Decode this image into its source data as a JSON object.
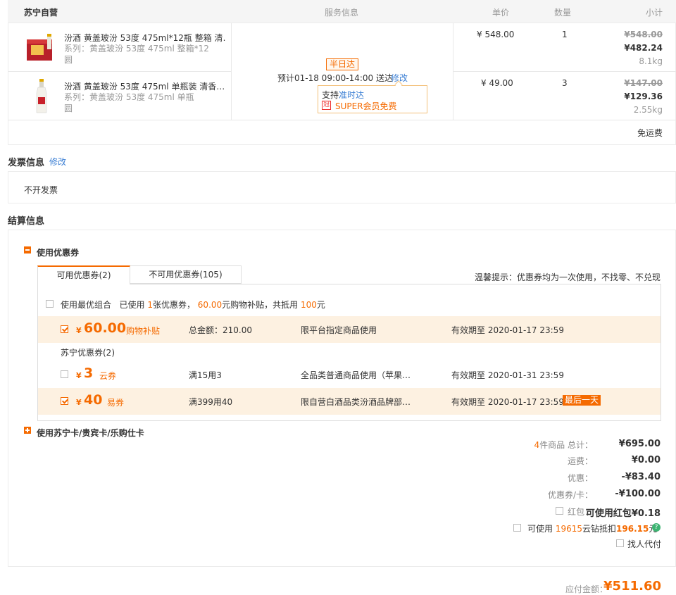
{
  "store": {
    "name": "苏宁自营",
    "col_service": "服务信息",
    "col_price": "单价",
    "col_qty": "数量",
    "col_subtotal": "小计"
  },
  "items": [
    {
      "title": "汾酒 黄盖玻汾 53度 475ml*12瓶 整箱 清…",
      "series": "系列：黄盖玻汾 53度 475ml 整箱*12",
      "tag": "圆",
      "price": "¥ 548.00",
      "qty": "1",
      "orig": "¥548.00",
      "final": "¥482.24",
      "weight": "8.1kg"
    },
    {
      "title": "汾酒 黄盖玻汾 53度 475ml 单瓶装 清香…",
      "series": "系列：黄盖玻汾 53度 475ml 单瓶",
      "tag": "圆",
      "price": "¥ 49.00",
      "qty": "3",
      "orig": "¥147.00",
      "final": "¥129.36",
      "weight": "2.55kg"
    }
  ],
  "delivery": {
    "badge": "半日达",
    "eta": "预计01-18 09:00-14:00  送达",
    "modify": "修改",
    "support_prefix": "支持",
    "support_link": "准时达",
    "super_icon": "冠",
    "super": "SUPER会员免费"
  },
  "shipping_free": "免运费",
  "invoice": {
    "title": "发票信息",
    "modify": "修改",
    "value": "不开发票"
  },
  "settle": {
    "title": "结算信息",
    "use_coupon": "使用优惠券",
    "tab_available": "可用优惠券(2)",
    "tab_unavailable": "不可用优惠券(105)",
    "tip": "温馨提示：优惠券均为一次使用，不找零、不兑现",
    "best_combo": {
      "label": "使用最优组合",
      "p1": "已使用",
      "count": "1",
      "p2": "张优惠券，",
      "amount": "60.00",
      "p3": "元购物补贴，共抵用",
      "total": "100",
      "p4": "元"
    },
    "coupons": [
      {
        "yen": "¥",
        "amount": "60.00",
        "type": "购物补贴",
        "cond": "总金额：210.00",
        "scope": "限平台指定商品使用",
        "expire": "有效期至 2020-01-17 23:59",
        "badge": "",
        "checked": true
      },
      {
        "yen": "¥",
        "amount": "3",
        "type": "云券",
        "cond": "满15用3",
        "scope": "全品类普通商品使用（苹果…",
        "expire": "有效期至 2020-01-31 23:59",
        "badge": "",
        "checked": false
      },
      {
        "yen": "¥",
        "amount": "40",
        "type": "易券",
        "cond": "满399用40",
        "scope": "限自营白酒品类汾酒品牌部…",
        "expire": "有效期至 2020-01-17 23:59",
        "badge": "最后一天",
        "checked": true
      }
    ],
    "group_title": "苏宁优惠券(2)",
    "use_card": "使用苏宁卡/贵宾卡/乐购仕卡"
  },
  "summary": {
    "count": "4",
    "count_label": "件商品 总计：",
    "total": "¥695.00",
    "freight_label": "运费：",
    "freight": "¥0.00",
    "discount_label": "优惠：",
    "discount": "-¥83.40",
    "coupon_label": "优惠券/卡：",
    "coupon": "-¥100.00",
    "redpack_label": "红包：",
    "redpack": "可使用红包¥0.18",
    "cloud_prefix": "可使用",
    "cloud_amount": "19615",
    "cloud_mid": "云钻抵扣",
    "cloud_value": "196.15",
    "cloud_suffix": "元",
    "help_icon": "?",
    "proxy": "找人代付",
    "payable_label": "应付金额：",
    "payable": "¥511.60"
  }
}
